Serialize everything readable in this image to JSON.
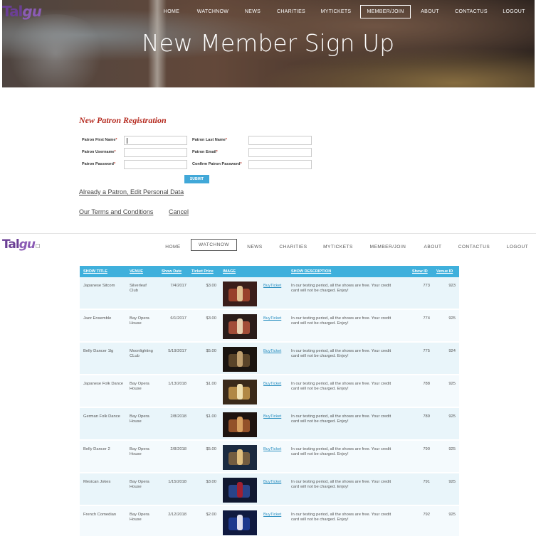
{
  "top_nav": {
    "logo": "Tal",
    "logo_u": "gu",
    "items": [
      "HOME",
      "WATCHNOW",
      "NEWS",
      "CHARITIES",
      "MYTICKETS",
      "MEMBER/JOIN",
      "ABOUT",
      "CONTACTUS",
      "LOGOUT"
    ],
    "selected": "MEMBER/JOIN"
  },
  "hero": {
    "title": "New Member Sign Up"
  },
  "form": {
    "title": "New Patron Registration",
    "first_name": "Patron First Name",
    "last_name": "Patron Last Name",
    "username": "Patron Username",
    "email": "Patron Email",
    "password": "Patron Password",
    "confirm_password": "Confirm Patron Password",
    "required_mark": "*",
    "submit": "SUBMIT",
    "edit_link": "Already a Patron, Edit Personal Data",
    "terms_link": "Our Terms and Conditions",
    "cancel_link": "Cancel"
  },
  "nav2": {
    "logo": "Tal",
    "logo_u": "gu",
    "items": [
      "HOME",
      "WATCHNOW",
      "NEWS",
      "CHARITIES",
      "MYTICKETS",
      "MEMBER/JOIN",
      "ABOUT",
      "CONTACTUS",
      "LOGOUT"
    ],
    "selected": "WATCHNOW"
  },
  "table": {
    "headers": [
      "SHOW TITLE",
      "VENUE",
      "Show Date",
      "Ticket Price",
      "IMAGE",
      "SHOW DESCRIPTION",
      "Show ID",
      "Venue ID"
    ],
    "buy_label": "BuyTicket",
    "rows": [
      {
        "title": "Japanese Sitcom",
        "venue": [
          "Silverleaf",
          "Club"
        ],
        "date": "7/4/2017",
        "price": "$3.00",
        "desc": [
          "In our testing period, all the shows are free. Your credit",
          "card will not be charged. Enjoy!"
        ],
        "show_id": "773",
        "venue_id": "923"
      },
      {
        "title": "Jazz Ensemble",
        "venue": [
          "Bay Opera",
          "House"
        ],
        "date": "6/1/2017",
        "price": "$3.00",
        "desc": [
          "In our testing period, all the shows are free. Your credit",
          "card will not be charged. Enjoy!"
        ],
        "show_id": "774",
        "venue_id": "925"
      },
      {
        "title": "Belly Dancer 1lg",
        "venue": [
          "Moonlighting",
          "CLub"
        ],
        "date": "5/19/2017",
        "price": "$5.00",
        "desc": [
          "In our testing period, all the shows are free. Your credit",
          "card will not be charged. Enjoy!"
        ],
        "show_id": "775",
        "venue_id": "924"
      },
      {
        "title": "Japanese Folk Dance",
        "venue": [
          "Bay Opera",
          "House"
        ],
        "date": "1/13/2018",
        "price": "$1.00",
        "desc": [
          "In our testing period, all the shows are free. Your credit",
          "card will not be charged. Enjoy!"
        ],
        "show_id": "788",
        "venue_id": "925"
      },
      {
        "title": "German Folk Dance",
        "venue": [
          "Bay Opera",
          "House"
        ],
        "date": "2/8/2018",
        "price": "$1.00",
        "desc": [
          "In our testing period, all the shows are free. Your credit",
          "card will not be charged. Enjoy!"
        ],
        "show_id": "789",
        "venue_id": "925"
      },
      {
        "title": "Belly Dancer 2",
        "venue": [
          "Bay Opera",
          "House"
        ],
        "date": "2/8/2018",
        "price": "$5.00",
        "desc": [
          "In our testing period, all the shows are free. Your credit",
          "card will not be charged. Enjoy!"
        ],
        "show_id": "790",
        "venue_id": "925"
      },
      {
        "title": "Mexican Jokes",
        "venue": [
          "Bay Opera",
          "House"
        ],
        "date": "1/15/2018",
        "price": "$3.00",
        "desc": [
          "In our testing period, all the shows are free. Your credit",
          "card will not be charged. Enjoy!"
        ],
        "show_id": "791",
        "venue_id": "925"
      },
      {
        "title": "French Comedian",
        "venue": [
          "Bay Opera",
          "House"
        ],
        "date": "2/12/2018",
        "price": "$2.00",
        "desc": [
          "In our testing period, all the shows are free. Your credit",
          "card will not be charged. Enjoy!"
        ],
        "show_id": "792",
        "venue_id": "925"
      }
    ]
  },
  "colors": {
    "accent": "#3fb0dc",
    "title_red": "#b52a1f",
    "logo": "#6b3f95",
    "row_a": "#e9f5fa",
    "row_b": "#f4fafd"
  }
}
